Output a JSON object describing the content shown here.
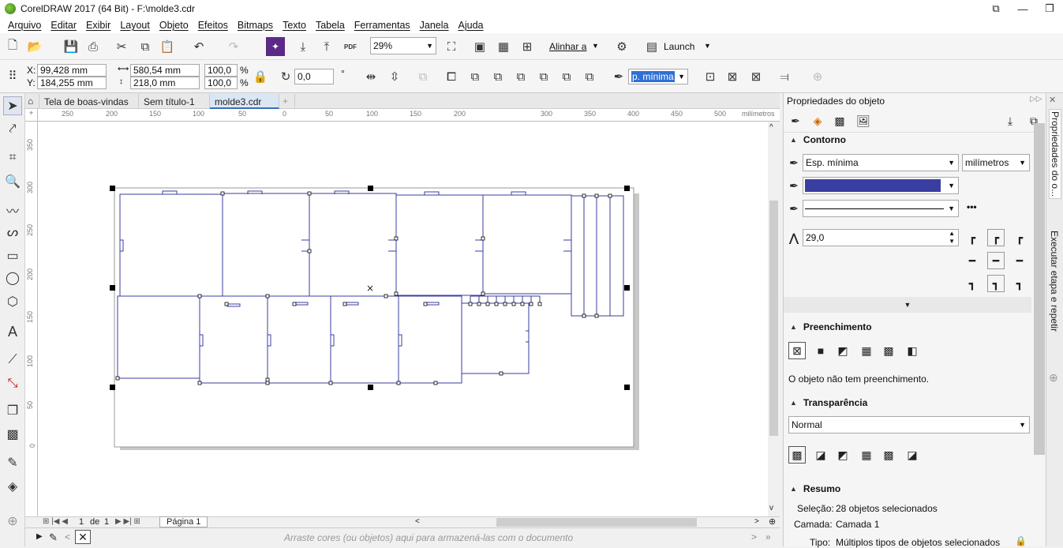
{
  "window": {
    "title": "CorelDRAW 2017 (64 Bit) - F:\\molde3.cdr",
    "controls": [
      "restore-icon",
      "minimize-icon",
      "maximize-icon"
    ]
  },
  "menu": [
    "Arquivo",
    "Editar",
    "Exibir",
    "Layout",
    "Objeto",
    "Efeitos",
    "Bitmaps",
    "Texto",
    "Tabela",
    "Ferramentas",
    "Janela",
    "Ajuda"
  ],
  "toolbar": {
    "zoom": "29%",
    "align_label": "Alinhar a",
    "launch_label": "Launch",
    "pdf_label": "PDF"
  },
  "propbar": {
    "x_label": "X:",
    "x_value": "99,428 mm",
    "y_label": "Y:",
    "y_value": "184,255 mm",
    "width_value": "580,54 mm",
    "height_value": "218,0 mm",
    "scale_w": "100,0",
    "scale_h": "100,0",
    "pct": "%",
    "rotation": "0,0",
    "degree": "°",
    "outline_width": "p. mínima"
  },
  "doc_tabs": [
    "Tela de boas-vindas",
    "Sem título-1",
    "molde3.cdr"
  ],
  "ruler": {
    "h_ticks": [
      "250",
      "200",
      "150",
      "100",
      "50",
      "0",
      "50",
      "100",
      "150",
      "200",
      "300",
      "350",
      "400",
      "450",
      "500"
    ],
    "unit": "milímetros",
    "v_ticks": [
      "350",
      "300",
      "250",
      "200",
      "150",
      "100",
      "50",
      "0"
    ]
  },
  "page_nav": {
    "current": "1",
    "of": "de",
    "total": "1",
    "page_tab": "Página 1"
  },
  "palette_hint": "Arraste cores (ou objetos) aqui para armazená-las com o documento",
  "panel": {
    "title": "Propriedades do objeto",
    "contorno": {
      "heading": "Contorno",
      "width": "Esp. mínima",
      "units": "milímetros",
      "color": "#3a3ea0",
      "miter": "29,0"
    },
    "preenchimento": {
      "heading": "Preenchimento",
      "status": "O objeto não tem preenchimento."
    },
    "transparencia": {
      "heading": "Transparência",
      "mode": "Normal"
    },
    "resumo": {
      "heading": "Resumo",
      "selecao_label": "Seleção:",
      "selecao_value": "28 objetos selecionados",
      "camada_label": "Camada:",
      "camada_value": "Camada 1",
      "tipo_label": "Tipo:",
      "tipo_value": "Múltiplos tipos de objetos selecionados"
    }
  },
  "docker_tabs": [
    "Propriedades do o...",
    "Executar etapa e repetir"
  ]
}
